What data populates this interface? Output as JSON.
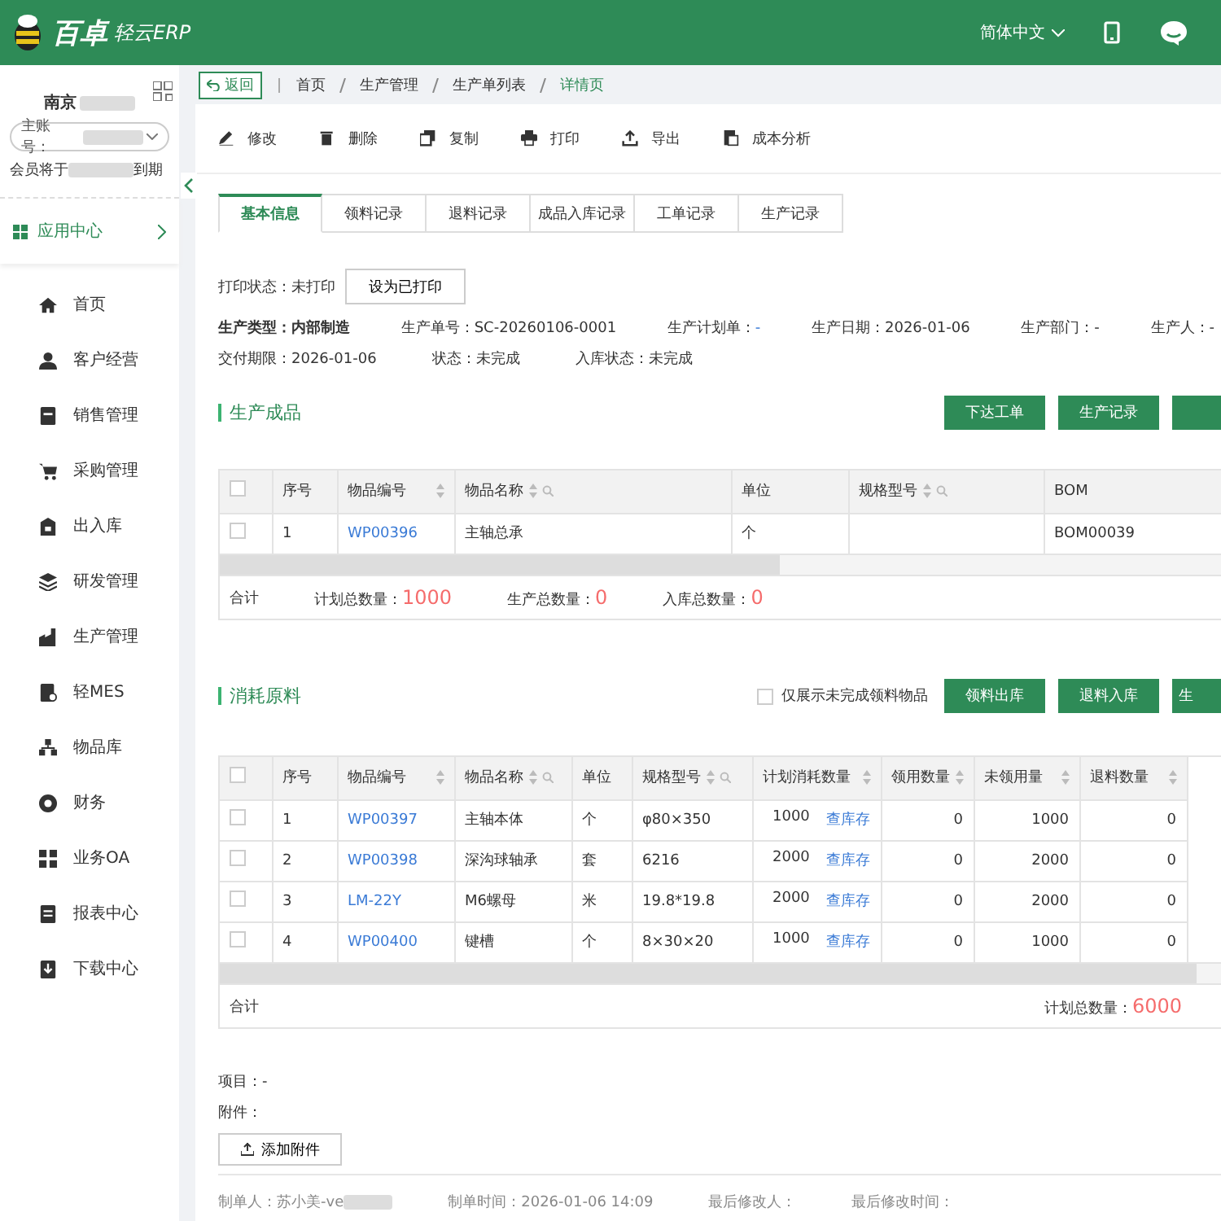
{
  "header": {
    "logo_main": "百卓",
    "logo_sub": "轻云ERP",
    "language": "简体中文"
  },
  "sidebar": {
    "company": "南京",
    "account_label": "主账号：",
    "membership_prefix": "会员将于",
    "membership_suffix": "到期",
    "app_center": "应用中心",
    "items": [
      {
        "label": "首页"
      },
      {
        "label": "客户经营"
      },
      {
        "label": "销售管理"
      },
      {
        "label": "采购管理"
      },
      {
        "label": "出入库"
      },
      {
        "label": "研发管理"
      },
      {
        "label": "生产管理"
      },
      {
        "label": "轻MES"
      },
      {
        "label": "物品库"
      },
      {
        "label": "财务"
      },
      {
        "label": "业务OA"
      },
      {
        "label": "报表中心"
      },
      {
        "label": "下载中心"
      }
    ]
  },
  "breadcrumb": {
    "back": "返回",
    "items": [
      {
        "label": "首页",
        "selected": false
      },
      {
        "label": "生产管理",
        "selected": false
      },
      {
        "label": "生产单列表",
        "selected": false
      },
      {
        "label": "详情页",
        "selected": true
      }
    ]
  },
  "toolbar": [
    "修改",
    "删除",
    "复制",
    "打印",
    "导出",
    "成本分析"
  ],
  "tabs": [
    {
      "label": "基本信息",
      "selected": true
    },
    {
      "label": "领料记录",
      "selected": false
    },
    {
      "label": "退料记录",
      "selected": false
    },
    {
      "label": "成品入库记录",
      "selected": false
    },
    {
      "label": "工单记录",
      "selected": false
    },
    {
      "label": "生产记录",
      "selected": false
    }
  ],
  "print_status": {
    "label": "打印状态：未打印",
    "button": "设为已打印"
  },
  "info_rows": [
    [
      {
        "label": "生产类型：",
        "value": "内部制造",
        "kind": "bold"
      },
      {
        "label": "生产单号：",
        "value": "SC-20260106-0001",
        "kind": "plain"
      },
      {
        "label": "生产计划单：",
        "value": "-",
        "kind": "link"
      },
      {
        "label": "生产日期：",
        "value": "2026-01-06",
        "kind": "plain"
      },
      {
        "label": "生产部门：",
        "value": "-",
        "kind": "plain"
      },
      {
        "label": "生产人：",
        "value": "-",
        "kind": "plain"
      }
    ],
    [
      {
        "label": "交付期限：",
        "value": "2026-01-06",
        "kind": "plain"
      },
      {
        "label": "状态：",
        "value": "未完成",
        "kind": "plain"
      },
      {
        "label": "入库状态：",
        "value": "未完成",
        "kind": "plain"
      }
    ]
  ],
  "products": {
    "title": "生产成品",
    "actions": [
      "下达工单",
      "生产记录"
    ],
    "columns": [
      {
        "label": "序号",
        "kind": "text",
        "sort": false,
        "search": false
      },
      {
        "label": "物品编号",
        "kind": "link",
        "sort": true,
        "search": false
      },
      {
        "label": "物品名称",
        "kind": "text",
        "sort": true,
        "search": true
      },
      {
        "label": "单位",
        "kind": "text",
        "sort": false,
        "search": false
      },
      {
        "label": "规格型号",
        "kind": "text",
        "sort": true,
        "search": true
      },
      {
        "label": "BOM",
        "kind": "text",
        "sort": false,
        "search": false
      }
    ],
    "all_checked": false,
    "rows": [
      {
        "checked": false,
        "cells": [
          "1",
          "WP00396",
          "主轴总承",
          "个",
          "",
          "BOM00039"
        ]
      }
    ],
    "summary_label": "合计",
    "totals": [
      {
        "label": "计划总数量：",
        "value": "1000"
      },
      {
        "label": "生产总数量：",
        "value": "0"
      },
      {
        "label": "入库总数量：",
        "value": "0"
      }
    ]
  },
  "materials": {
    "title": "消耗原料",
    "filter": {
      "label": "仅展示未完成领料物品",
      "checked": false
    },
    "actions": [
      "领料出库",
      "退料入库",
      "生"
    ],
    "columns": [
      {
        "label": "序号",
        "kind": "text",
        "sort": false,
        "search": false
      },
      {
        "label": "物品编号",
        "kind": "link",
        "sort": true,
        "search": false
      },
      {
        "label": "物品名称",
        "kind": "text",
        "sort": true,
        "search": true
      },
      {
        "label": "单位",
        "kind": "text",
        "sort": false,
        "search": false
      },
      {
        "label": "规格型号",
        "kind": "text",
        "sort": true,
        "search": true
      },
      {
        "label": "计划消耗数量",
        "kind": "stock",
        "sort": true,
        "search": false
      },
      {
        "label": "领用数量",
        "kind": "number",
        "sort": true,
        "search": false
      },
      {
        "label": "未领用量",
        "kind": "number",
        "sort": true,
        "search": false
      },
      {
        "label": "退料数量",
        "kind": "number",
        "sort": true,
        "search": false
      }
    ],
    "all_checked": false,
    "rows": [
      {
        "checked": false,
        "stock_link": "查库存",
        "cells": [
          "1",
          "WP00397",
          "主轴本体",
          "个",
          "φ80×350",
          "1000",
          "0",
          "1000",
          "0"
        ]
      },
      {
        "checked": false,
        "stock_link": "查库存",
        "cells": [
          "2",
          "WP00398",
          "深沟球轴承",
          "套",
          "6216",
          "2000",
          "0",
          "2000",
          "0"
        ]
      },
      {
        "checked": false,
        "stock_link": "查库存",
        "cells": [
          "3",
          "LM-22Y",
          "M6螺母",
          "米",
          "19.8*19.8",
          "2000",
          "0",
          "2000",
          "0"
        ]
      },
      {
        "checked": false,
        "stock_link": "查库存",
        "cells": [
          "4",
          "WP00400",
          "键槽",
          "个",
          "8×30×20",
          "1000",
          "0",
          "1000",
          "0"
        ]
      }
    ],
    "summary_label": "合计",
    "totals": [
      {
        "label": "计划总数量：",
        "value": "6000"
      }
    ]
  },
  "project": "项目：-",
  "attachment_label": "附件：",
  "add_attachment": "添加附件",
  "footer": [
    "制单人：苏小美-ve",
    "制单时间：2026-01-06 14:09",
    "最后修改人：",
    "最后修改时间："
  ]
}
